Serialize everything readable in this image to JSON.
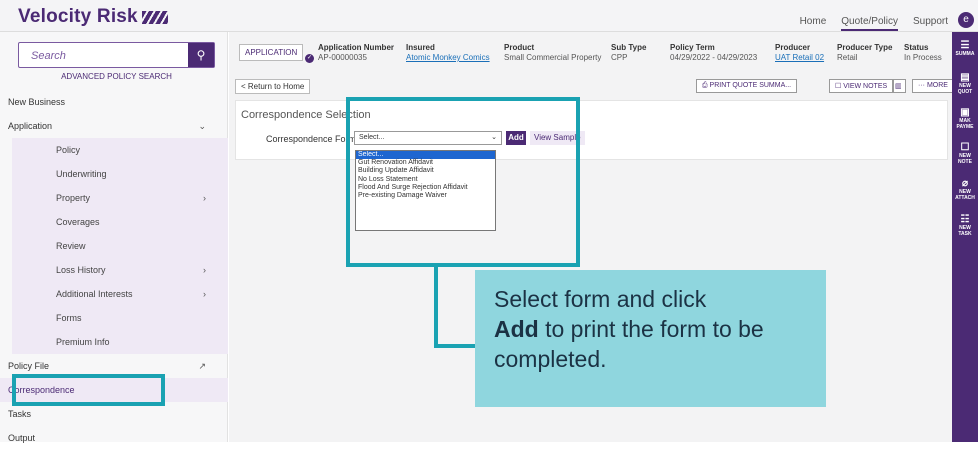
{
  "header": {
    "logo_text": "Velocity Risk",
    "nav": [
      "Home",
      "Quote/Policy",
      "Support"
    ],
    "user_initial": "e"
  },
  "sidebar": {
    "search_placeholder": "Search",
    "advanced_search": "ADVANCED POLICY SEARCH",
    "items": [
      {
        "label": "New Business"
      },
      {
        "label": "Application",
        "chevron": "⌄"
      },
      {
        "label": "Policy"
      },
      {
        "label": "Underwriting"
      },
      {
        "label": "Property",
        "chevron": "›"
      },
      {
        "label": "Coverages"
      },
      {
        "label": "Review"
      },
      {
        "label": "Loss History",
        "chevron": "›"
      },
      {
        "label": "Additional Interests",
        "chevron": "›"
      },
      {
        "label": "Forms"
      },
      {
        "label": "Premium Info"
      },
      {
        "label": "Policy File",
        "chevron": "↗"
      },
      {
        "label": "Correspondence"
      },
      {
        "label": "Tasks"
      },
      {
        "label": "Output"
      }
    ]
  },
  "appbar": {
    "badge": "APPLICATION",
    "fields": [
      {
        "label": "Application Number",
        "value": "AP-00000035"
      },
      {
        "label": "Insured",
        "value": "Atomic Monkey Comics"
      },
      {
        "label": "Product",
        "value": "Small Commercial Property"
      },
      {
        "label": "Sub Type",
        "value": "CPP"
      },
      {
        "label": "Policy Term",
        "value": "04/29/2022 - 04/29/2023"
      },
      {
        "label": "Producer",
        "value": "UAT Retail 02"
      },
      {
        "label": "Producer Type",
        "value": "Retail"
      },
      {
        "label": "Status",
        "value": "In Process"
      }
    ]
  },
  "toolbar": {
    "return": "< Return to Home",
    "print": "⎙ PRINT QUOTE SUMMA...",
    "notes": "☐ VIEW NOTES",
    "delete": "🗑 DELETE",
    "more": "··· MORE"
  },
  "card": {
    "title": "Correspondence Selection",
    "label": "Correspondence Form*",
    "select_value": "Select...",
    "add": "Add",
    "sample": "View Sample"
  },
  "dropdown_options": [
    "Select...",
    "Gut Renovation Affidavit",
    "Building Update Affidavit",
    "No Loss Statement",
    "Flood And Surge Rejection Affidavit",
    "Pre-existing Damage Waiver"
  ],
  "callout": {
    "line1": "Select form and click",
    "bold": "Add",
    "rest": " to print the form to be completed."
  },
  "rightbar": [
    {
      "icon": "☰",
      "label": "SUMMA"
    },
    {
      "icon": "▤",
      "label": "NEW QUOT"
    },
    {
      "icon": "▣",
      "label": "MAK PAYME"
    },
    {
      "icon": "☐",
      "label": "NEW NOTE"
    },
    {
      "icon": "⌀",
      "label": "NEW ATTACH"
    },
    {
      "icon": "☷",
      "label": "NEW TASK"
    }
  ],
  "colors": {
    "brand": "#4b2a74",
    "callout": "#1aa2b2",
    "callout_bg": "#8fd6de"
  }
}
